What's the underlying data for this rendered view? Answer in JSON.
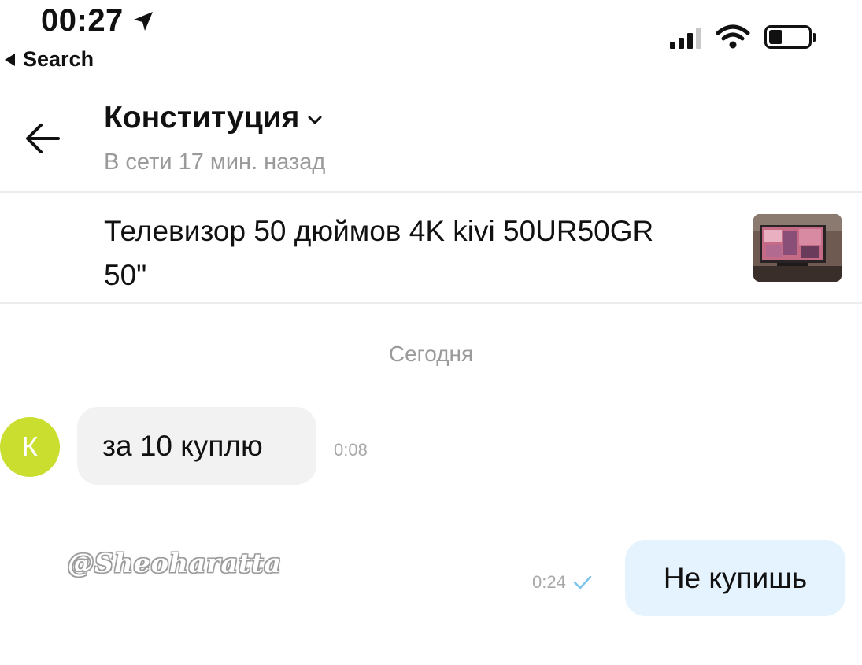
{
  "status_bar": {
    "time": "00:27",
    "back_label": "Search",
    "battery_percent": 35
  },
  "header": {
    "title": "Конституция",
    "subtitle": "В сети 17 мин. назад"
  },
  "product": {
    "title": "Телевизор 50 дюймов 4K kivi 50UR50GR 50\""
  },
  "chat": {
    "date_label": "Сегодня",
    "messages": [
      {
        "direction": "incoming",
        "avatar_letter": "К",
        "text": "за 10 куплю",
        "time": "0:08"
      },
      {
        "direction": "outgoing",
        "text": "Не купишь",
        "time": "0:24",
        "status": "sent"
      }
    ]
  },
  "watermark": "@Sheoharatta",
  "colors": {
    "avatar": "#c9de2f",
    "incoming_bubble": "#f2f2f2",
    "outgoing_bubble": "#e4f3fd",
    "check": "#7cc4ee",
    "muted_text": "#9a9a9a"
  }
}
